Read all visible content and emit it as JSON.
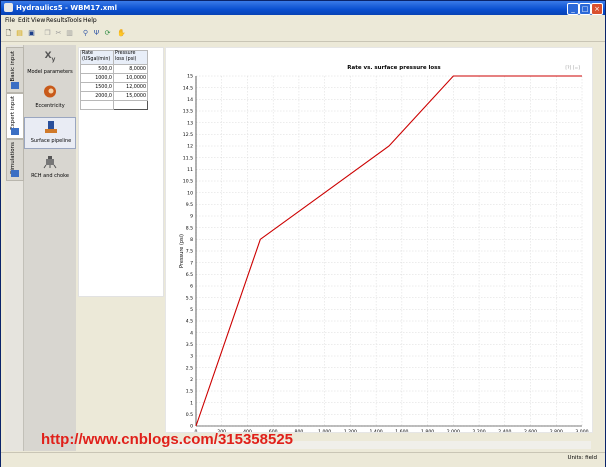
{
  "window": {
    "title": "Hydraulics5 - WBM17.xml"
  },
  "menu": [
    "File",
    "Edit",
    "View",
    "Results",
    "Tools",
    "Help"
  ],
  "toolbar": {
    "icons": [
      "new-icon",
      "open-icon",
      "save-icon",
      "copy-icon",
      "cut-icon",
      "paste-icon",
      "filter-icon",
      "chart-icon",
      "refresh-icon",
      "hand-icon"
    ]
  },
  "side_tabs": [
    {
      "label": "Basic input"
    },
    {
      "label": "Expert input"
    },
    {
      "label": "Simulations"
    }
  ],
  "panel_items": [
    {
      "label": "Model parameters",
      "icon": "xy-icon"
    },
    {
      "label": "Eccentricity",
      "icon": "eccentricity-icon"
    },
    {
      "label": "Surface pipeline",
      "icon": "pipeline-icon"
    },
    {
      "label": "RCH and choke",
      "icon": "choke-icon"
    }
  ],
  "grid": {
    "headers": [
      "Rate (USgal/min)",
      "Pressure loss (psi)"
    ],
    "rows": [
      [
        "500,0",
        "8,0000"
      ],
      [
        "1000,0",
        "10,0000"
      ],
      [
        "1500,0",
        "12,0000"
      ],
      [
        "2000,0",
        "15,0000"
      ]
    ]
  },
  "watermark": "http://www.cnblogs.com/315358525",
  "status": "Units: field",
  "chart_data": {
    "type": "line",
    "title": "Rate vs. surface pressure loss",
    "ylabel": "Pressure (psi)",
    "xlabel": "",
    "corner_label": "[?] [=]",
    "xlim": [
      0,
      3000
    ],
    "ylim": [
      0,
      15
    ],
    "xticks": [
      "0",
      "200",
      "400",
      "600",
      "800",
      "1 000",
      "1 200",
      "1 400",
      "1 600",
      "1 800",
      "2 000",
      "2 200",
      "2 400",
      "2 600",
      "2 800",
      "3 000"
    ],
    "yticks": [
      "0",
      "0.5",
      "1",
      "1.5",
      "2",
      "2.5",
      "3",
      "3.5",
      "4",
      "4.5",
      "5",
      "5.5",
      "6",
      "6.5",
      "7",
      "7.5",
      "8",
      "8.5",
      "9",
      "9.5",
      "10",
      "10.5",
      "11",
      "11.5",
      "12",
      "12.5",
      "13",
      "13.5",
      "14",
      "14.5",
      "15"
    ],
    "grid": true,
    "series": [
      {
        "x": [
          0,
          500,
          1000,
          1500,
          2000,
          3000
        ],
        "y": [
          0,
          8,
          10,
          12,
          15,
          15
        ],
        "color": "#cc0000"
      }
    ]
  }
}
